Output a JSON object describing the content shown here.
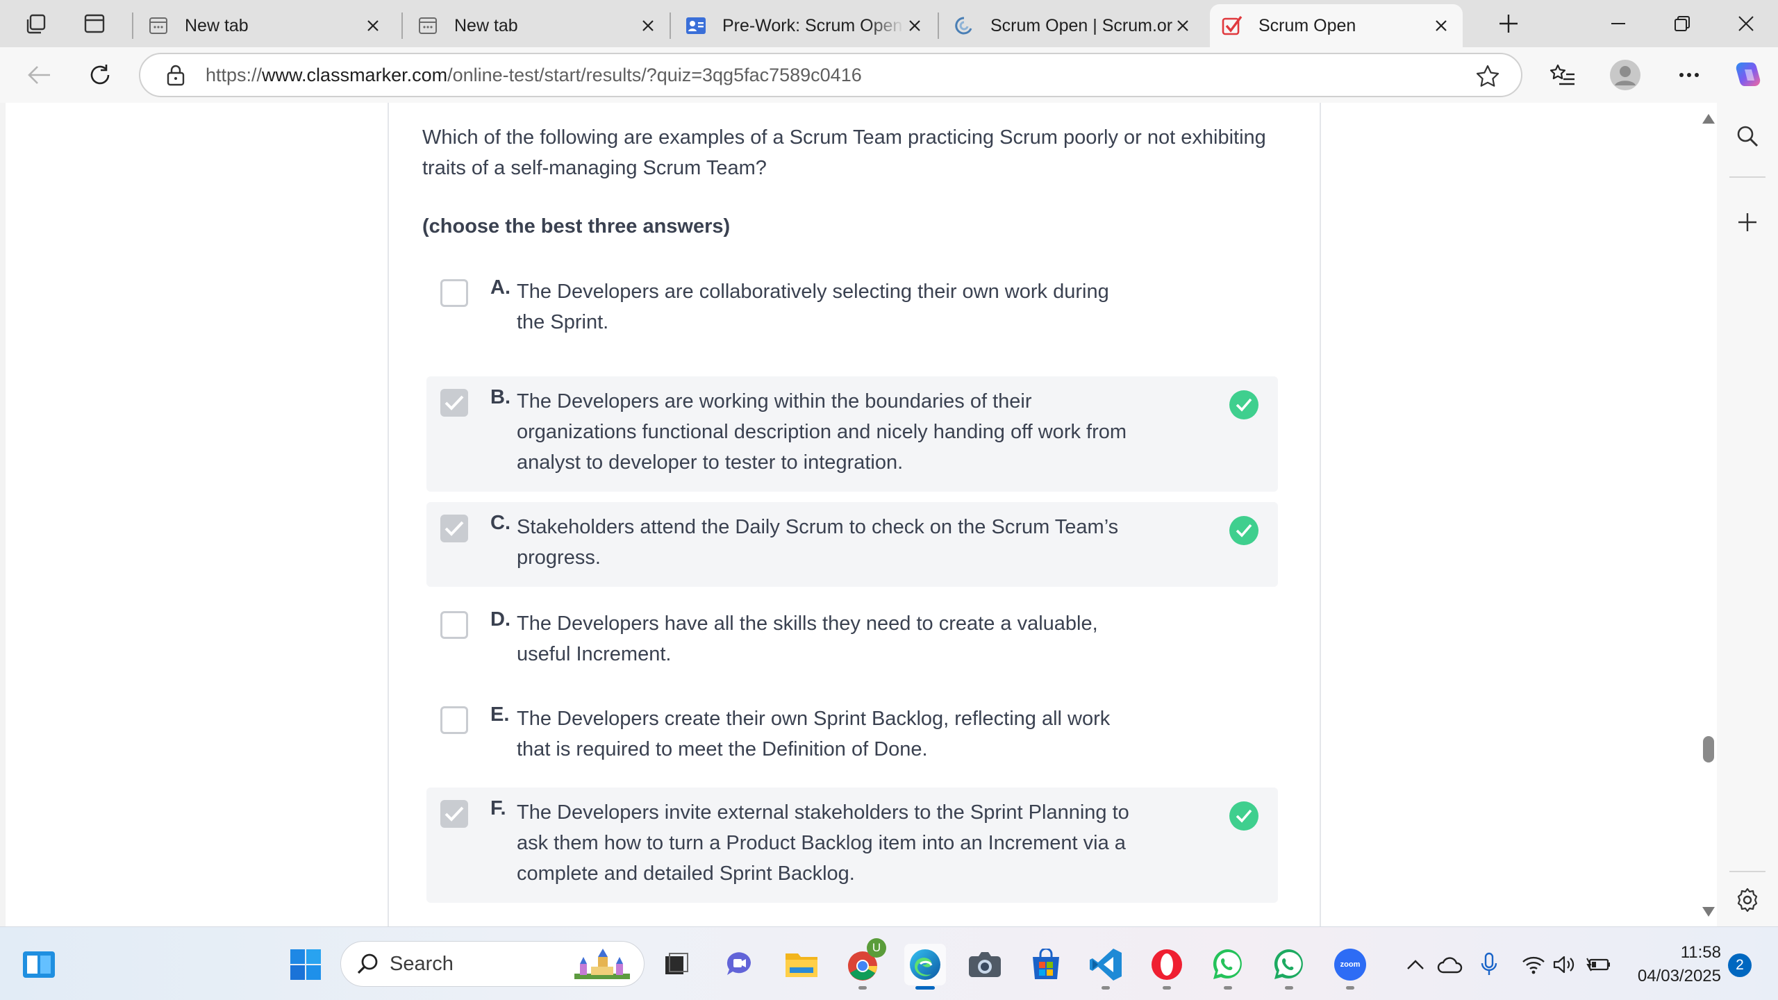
{
  "browser": {
    "tabs": [
      {
        "title": "New tab",
        "icon": "new-tab-icon"
      },
      {
        "title": "New tab",
        "icon": "new-tab-icon"
      },
      {
        "title": "Pre-Work: Scrum Open Assessment",
        "icon": "profile-card-icon"
      },
      {
        "title": "Scrum Open | Scrum.org",
        "icon": "scrum-org-icon"
      },
      {
        "title": "Scrum Open",
        "icon": "classmarker-check-icon",
        "active": true
      }
    ],
    "url_prefix": "https://",
    "url_host": "www.classmarker.com",
    "url_path": "/online-test/start/results/?quiz=3qg5fac7589c0416"
  },
  "quiz": {
    "question": "Which of the following are examples of a Scrum Team practicing Scrum poorly or not exhibiting traits of a self-managing Scrum Team?",
    "instruction": "(choose the best three answers)",
    "answers": [
      {
        "letter": "A.",
        "text": "The Developers are collaboratively selecting their own work during the Sprint.",
        "checked": false,
        "correct": false
      },
      {
        "letter": "B.",
        "text": "The Developers are working within the boundaries of their organizations functional description and nicely handing off work from analyst to developer to tester to integration.",
        "checked": true,
        "correct": true
      },
      {
        "letter": "C.",
        "text": "Stakeholders attend the Daily Scrum to check on the Scrum Team’s progress.",
        "checked": true,
        "correct": true
      },
      {
        "letter": "D.",
        "text": "The Developers have all the skills they need to create a valuable, useful Increment.",
        "checked": false,
        "correct": false
      },
      {
        "letter": "E.",
        "text": "The Developers create their own Sprint Backlog, reflecting all work that is required to meet the Definition of Done.",
        "checked": false,
        "correct": false
      },
      {
        "letter": "F.",
        "text": "The Developers invite external stakeholders to the Sprint Planning to ask them how to turn a Product Backlog item into an Increment via a complete and detailed Sprint Backlog.",
        "checked": true,
        "correct": true
      }
    ]
  },
  "taskbar": {
    "search_placeholder": "Search",
    "time": "11:58",
    "date": "04/03/2025",
    "notification_count": "2",
    "chrome_badge": "U",
    "zoom_label": "zoom"
  },
  "colors": {
    "correct": "#3fcf8e",
    "text": "#3a4150",
    "selected_bg": "#f4f5f7",
    "accent": "#0067c0"
  }
}
